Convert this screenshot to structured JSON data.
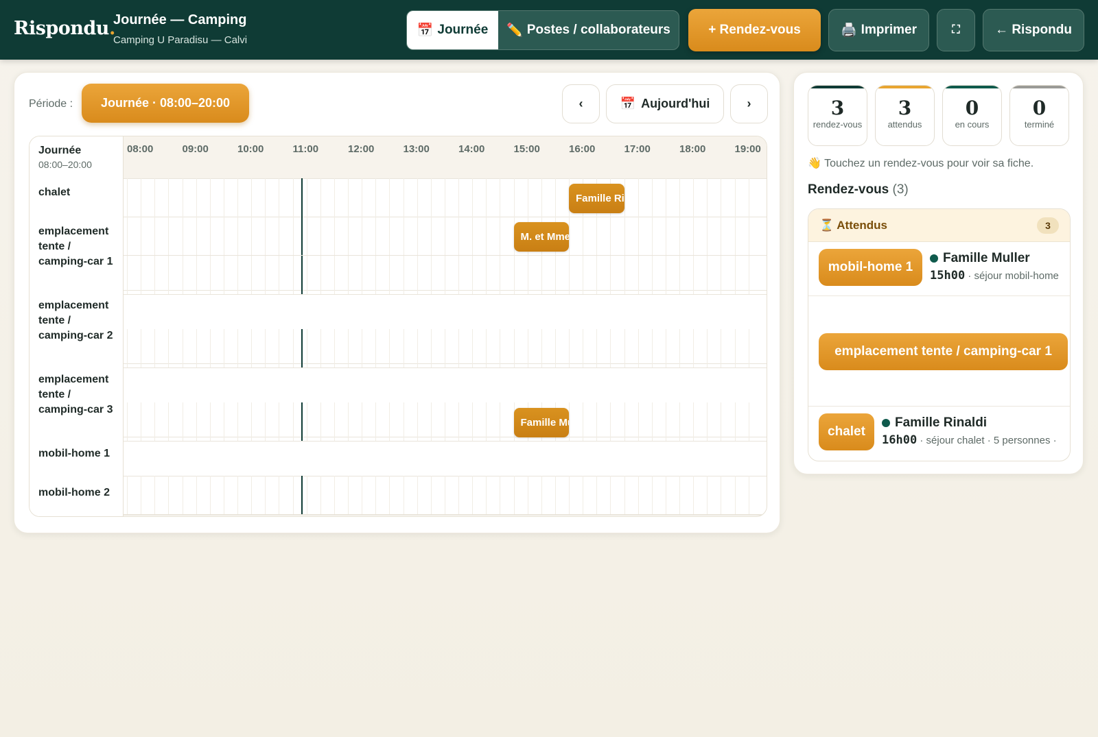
{
  "header": {
    "logo": "Rispondu",
    "logo_dot": ".",
    "title": "Journée — Camping",
    "subtitle": "Camping U Paradisu — Calvi",
    "tabs": [
      {
        "icon": "📅",
        "label": "Journée",
        "active": true
      },
      {
        "icon": "✏️",
        "label": "Postes / collaborateurs",
        "active": false
      }
    ],
    "new_button": "+ Rendez-vous",
    "print_button": {
      "icon": "🖨️",
      "label": "Imprimer"
    },
    "fullscreen_icon": "⛶",
    "back_button": "← Rispondu"
  },
  "toolbar": {
    "periode_label": "Période :",
    "periode_value": "Journée · 08:00–20:00",
    "prev": "‹",
    "today": {
      "icon": "📅",
      "label": "Aujourd'hui"
    },
    "next": "›"
  },
  "grid": {
    "corner_title": "Journée",
    "corner_sub": "08:00–20:00",
    "hours": [
      "08:00",
      "09:00",
      "10:00",
      "11:00",
      "12:00",
      "13:00",
      "14:00",
      "15:00",
      "16:00",
      "17:00",
      "18:00",
      "19:00"
    ],
    "rows": [
      {
        "label": "chalet"
      },
      {
        "label": "emplacement tente / camping-car 1"
      },
      {
        "label": "emplacement tente / camping-car 2"
      },
      {
        "label": "emplacement tente / camping-car 3"
      },
      {
        "label": "mobil-home 1"
      },
      {
        "label": "mobil-home 2"
      }
    ],
    "now_time": "11:09",
    "events": [
      {
        "row": 0,
        "label": "Famille Rinaldi",
        "start": "16:00",
        "end": "17:00"
      },
      {
        "row": 1,
        "label": "M. et Mme",
        "start": "15:00",
        "end": "16:00"
      },
      {
        "row": 4,
        "label": "Famille Muller",
        "start": "15:00",
        "end": "16:00"
      }
    ]
  },
  "stats": [
    {
      "value": "3",
      "label": "rendez-vous",
      "color": "#0f3b35"
    },
    {
      "value": "3",
      "label": "attendus",
      "color": "#e8a531"
    },
    {
      "value": "0",
      "label": "en cours",
      "color": "#0f5a4c"
    },
    {
      "value": "0",
      "label": "terminé",
      "color": "#9a9a96"
    }
  ],
  "side": {
    "hint": "👋 Touchez un rendez-vous pour voir sa fiche.",
    "rdv_title": "Rendez-vous",
    "rdv_count": "(3)",
    "group_title": "⏳ Attendus",
    "group_count": "3",
    "items": [
      {
        "tag": "mobil-home 1",
        "name": "Famille Muller",
        "time": "15h00",
        "detail": " · séjour mobil-home"
      },
      {
        "tag": "emplacement tente / camping-car 1",
        "name": "",
        "time": "",
        "detail": ""
      },
      {
        "tag": "chalet",
        "name": "Famille Rinaldi",
        "time": "16h00",
        "detail": " · séjour chalet · 5 personnes ·"
      }
    ]
  },
  "colors": {
    "header_bg": "#0f3b35",
    "accent_orange": "#e8a531",
    "event_orange": "#d0881a",
    "status_green": "#0f5a4c"
  }
}
